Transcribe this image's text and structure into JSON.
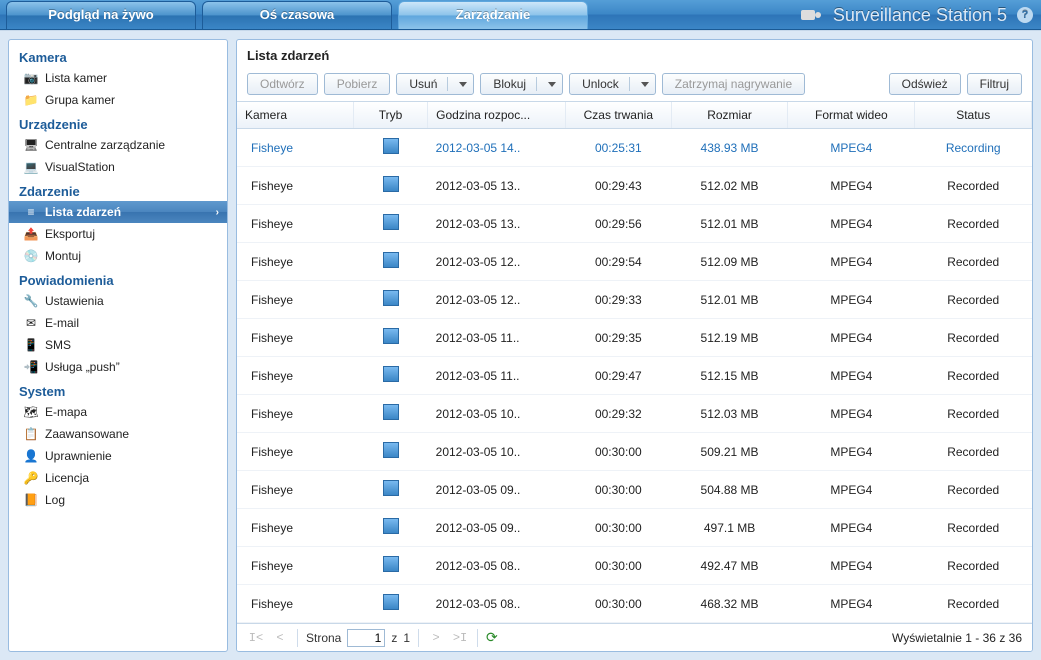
{
  "app": {
    "title": "Surveillance Station 5",
    "tabs": [
      "Podgląd na żywo",
      "Oś czasowa",
      "Zarządzanie"
    ],
    "active_tab": 2
  },
  "sidebar": {
    "groups": [
      {
        "title": "Kamera",
        "items": [
          {
            "icon": "icn-camera",
            "label": "Lista kamer"
          },
          {
            "icon": "icn-group",
            "label": "Grupa kamer"
          }
        ]
      },
      {
        "title": "Urządzenie",
        "items": [
          {
            "icon": "icn-central",
            "label": "Centralne zarządzanie"
          },
          {
            "icon": "icn-visual",
            "label": "VisualStation"
          }
        ]
      },
      {
        "title": "Zdarzenie",
        "items": [
          {
            "icon": "icn-list",
            "label": "Lista zdarzeń",
            "active": true,
            "has_sub": true
          },
          {
            "icon": "icn-export",
            "label": "Eksportuj"
          },
          {
            "icon": "icn-mount",
            "label": "Montuj"
          }
        ]
      },
      {
        "title": "Powiadomienia",
        "items": [
          {
            "icon": "icn-settings",
            "label": "Ustawienia"
          },
          {
            "icon": "icn-email",
            "label": "E-mail"
          },
          {
            "icon": "icn-sms",
            "label": "SMS"
          },
          {
            "icon": "icn-push",
            "label": "Usługa „push”"
          }
        ]
      },
      {
        "title": "System",
        "items": [
          {
            "icon": "icn-map",
            "label": "E-mapa"
          },
          {
            "icon": "icn-adv",
            "label": "Zaawansowane"
          },
          {
            "icon": "icn-perm",
            "label": "Uprawnienie"
          },
          {
            "icon": "icn-lic",
            "label": "Licencja"
          },
          {
            "icon": "icn-log",
            "label": "Log"
          }
        ]
      }
    ]
  },
  "main": {
    "title": "Lista zdarzeń",
    "toolbar": {
      "play": "Odtwórz",
      "download": "Pobierz",
      "delete": "Usuń",
      "lock": "Blokuj",
      "unlock": "Unlock",
      "stop_rec": "Zatrzymaj nagrywanie",
      "refresh": "Odśwież",
      "filter": "Filtruj"
    },
    "columns": [
      "Kamera",
      "Tryb",
      "Godzina rozpoc...",
      "Czas trwania",
      "Rozmiar",
      "Format wideo",
      "Status"
    ],
    "rows": [
      {
        "cam": "Fisheye",
        "time": "2012-03-05 14..",
        "dur": "00:25:31",
        "size": "438.93 MB",
        "vid": "MPEG4",
        "status": "Recording"
      },
      {
        "cam": "Fisheye",
        "time": "2012-03-05 13..",
        "dur": "00:29:43",
        "size": "512.02 MB",
        "vid": "MPEG4",
        "status": "Recorded"
      },
      {
        "cam": "Fisheye",
        "time": "2012-03-05 13..",
        "dur": "00:29:56",
        "size": "512.01 MB",
        "vid": "MPEG4",
        "status": "Recorded"
      },
      {
        "cam": "Fisheye",
        "time": "2012-03-05 12..",
        "dur": "00:29:54",
        "size": "512.09 MB",
        "vid": "MPEG4",
        "status": "Recorded"
      },
      {
        "cam": "Fisheye",
        "time": "2012-03-05 12..",
        "dur": "00:29:33",
        "size": "512.01 MB",
        "vid": "MPEG4",
        "status": "Recorded"
      },
      {
        "cam": "Fisheye",
        "time": "2012-03-05 11..",
        "dur": "00:29:35",
        "size": "512.19 MB",
        "vid": "MPEG4",
        "status": "Recorded"
      },
      {
        "cam": "Fisheye",
        "time": "2012-03-05 11..",
        "dur": "00:29:47",
        "size": "512.15 MB",
        "vid": "MPEG4",
        "status": "Recorded"
      },
      {
        "cam": "Fisheye",
        "time": "2012-03-05 10..",
        "dur": "00:29:32",
        "size": "512.03 MB",
        "vid": "MPEG4",
        "status": "Recorded"
      },
      {
        "cam": "Fisheye",
        "time": "2012-03-05 10..",
        "dur": "00:30:00",
        "size": "509.21 MB",
        "vid": "MPEG4",
        "status": "Recorded"
      },
      {
        "cam": "Fisheye",
        "time": "2012-03-05 09..",
        "dur": "00:30:00",
        "size": "504.88 MB",
        "vid": "MPEG4",
        "status": "Recorded"
      },
      {
        "cam": "Fisheye",
        "time": "2012-03-05 09..",
        "dur": "00:30:00",
        "size": "497.1 MB",
        "vid": "MPEG4",
        "status": "Recorded"
      },
      {
        "cam": "Fisheye",
        "time": "2012-03-05 08..",
        "dur": "00:30:00",
        "size": "492.47 MB",
        "vid": "MPEG4",
        "status": "Recorded"
      },
      {
        "cam": "Fisheye",
        "time": "2012-03-05 08..",
        "dur": "00:30:00",
        "size": "468.32 MB",
        "vid": "MPEG4",
        "status": "Recorded"
      }
    ],
    "footer": {
      "page_label": "Strona",
      "page": "1",
      "of_label": "z",
      "total_pages": "1",
      "range": "Wyświetalnie 1 - 36 z 36"
    }
  }
}
